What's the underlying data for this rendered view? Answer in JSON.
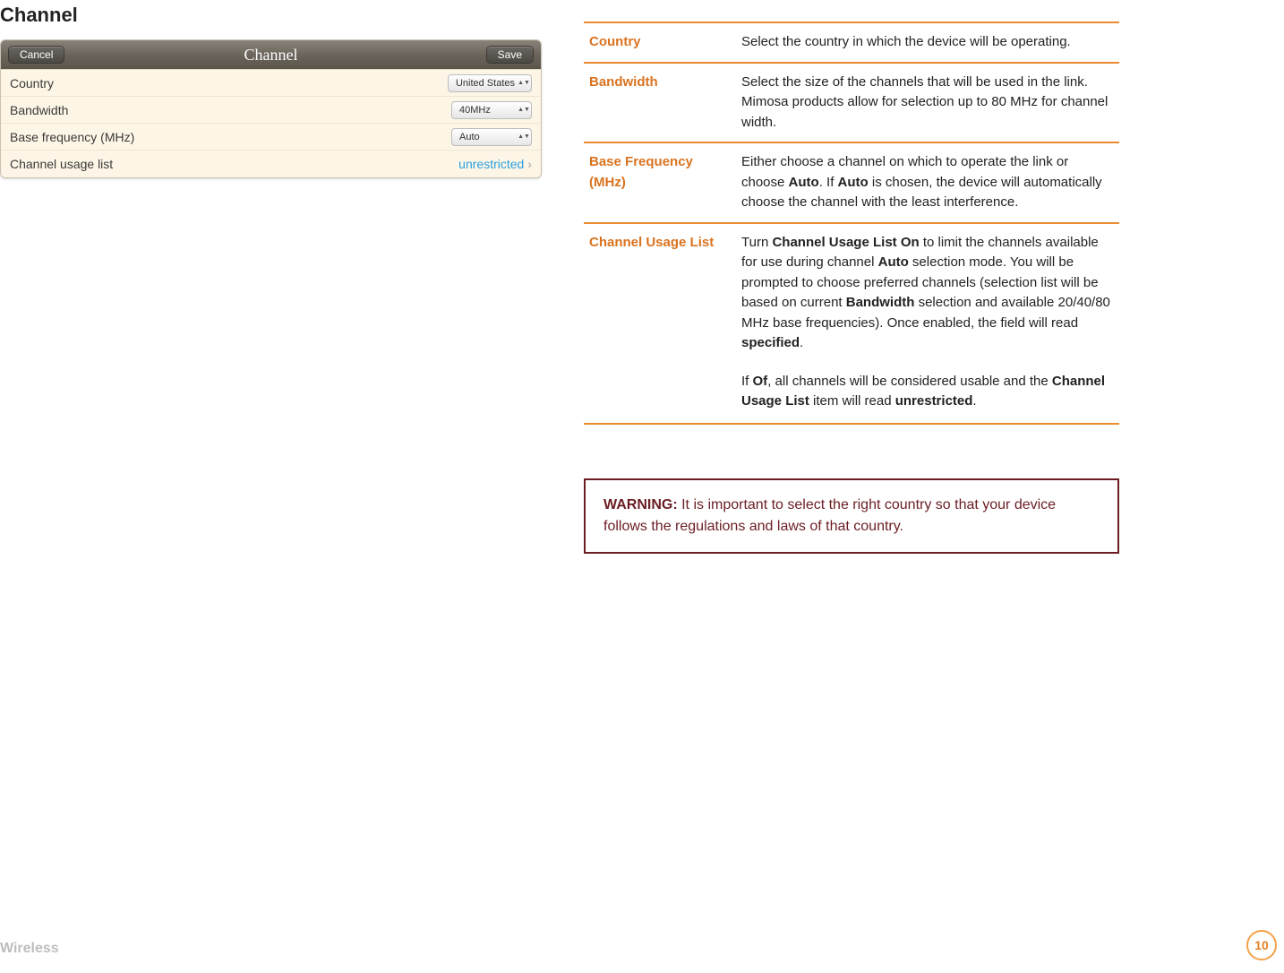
{
  "title": "Channel",
  "panel": {
    "title": "Channel",
    "cancel": "Cancel",
    "save": "Save",
    "rows": {
      "country": {
        "label": "Country",
        "value": "United States"
      },
      "bandwidth": {
        "label": "Bandwidth",
        "value": "40MHz"
      },
      "baseFreq": {
        "label": "Base frequency (MHz)",
        "value": "Auto"
      },
      "usageList": {
        "label": "Channel usage list",
        "value": "unrestricted"
      }
    }
  },
  "definitions": {
    "country": {
      "term": "Country",
      "body": "Select the country in which the device will be operating."
    },
    "bandwidth": {
      "term": "Bandwidth",
      "body": "Select the size of the channels that will be used in the link. Mimosa products allow for selection up to 80 MHz for channel width."
    },
    "baseFreq": {
      "term": "Base Frequency (MHz)",
      "body_pre": "Either choose a channel on which to operate the link or choose ",
      "auto1": "Auto",
      "body_mid1": ". If ",
      "auto2": "Auto",
      "body_post": " is chosen, the device will automatically choose the channel with the least interference."
    },
    "usageList": {
      "term": "Channel Usage List",
      "p1_pre": "Turn ",
      "p1_b1": "Channel Usage List On",
      "p1_mid1": " to limit the channels available for use during channel ",
      "p1_b2": "Auto",
      "p1_mid2": " selection mode. You will be prompted to choose preferred channels (selection list will be based on current ",
      "p1_b3": "Bandwidth",
      "p1_mid3": " selection and available 20/40/80 MHz base frequencies). Once enabled, the field will read ",
      "p1_b4": "specified",
      "p1_post": ".",
      "p2_pre": "If ",
      "p2_b1": "Of",
      "p2_mid1": ", all channels will be considered usable and the ",
      "p2_b2": "Channel Usage List",
      "p2_mid2": " item will read ",
      "p2_b3": "unrestricted",
      "p2_post": "."
    }
  },
  "warning": {
    "lead": "WARNING:",
    "body": " It is important to select the right country so that your device follows the regulations and laws of that country."
  },
  "footer": {
    "section": "Wireless",
    "page": "10"
  }
}
